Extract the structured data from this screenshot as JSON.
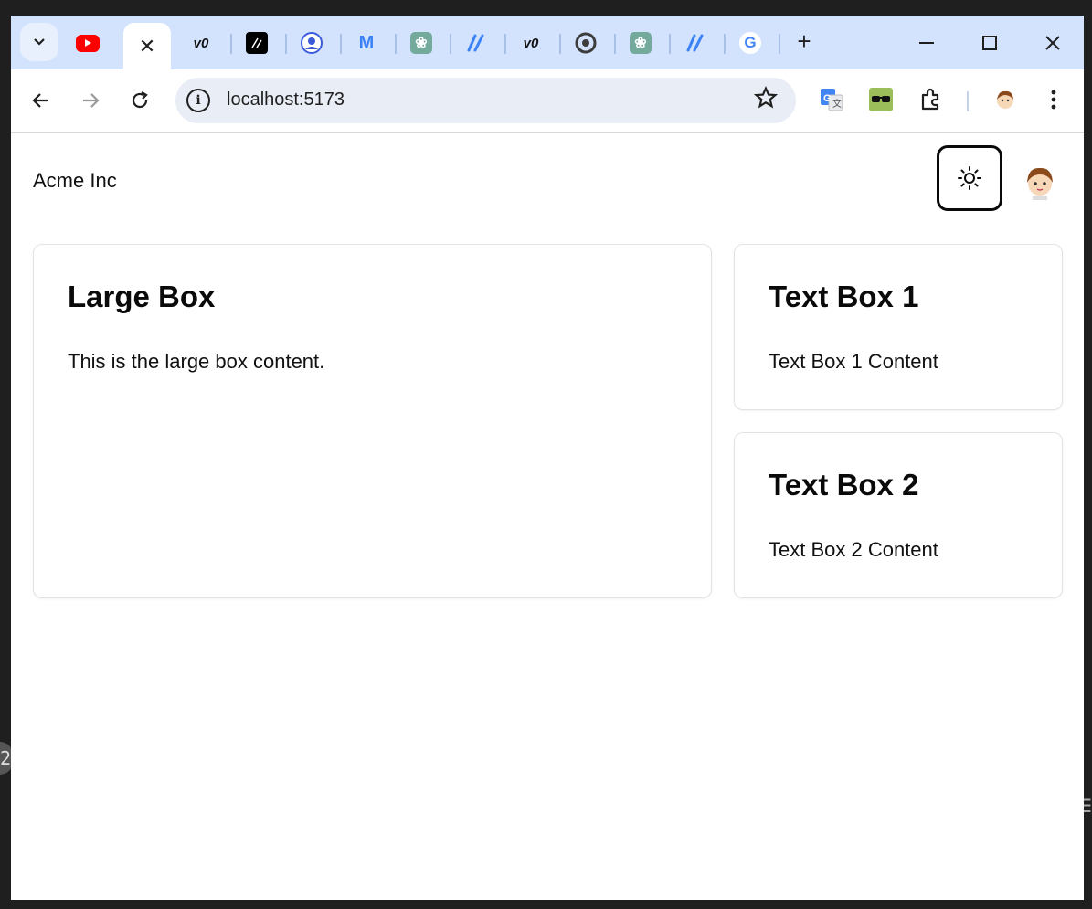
{
  "browser": {
    "url": "localhost:5173",
    "tabs": [
      {
        "icon": "youtube-icon",
        "color": "#ff0000"
      },
      {
        "icon": "close-icon",
        "glyph": "✕",
        "active": true
      },
      {
        "icon": "v0-icon",
        "glyph": "v0"
      },
      {
        "icon": "slash-app-icon",
        "glyph": "⁄⁄"
      },
      {
        "icon": "profile-circle-icon"
      },
      {
        "icon": "mui-icon",
        "glyph": "M"
      },
      {
        "icon": "chatgpt-icon",
        "glyph": "❀"
      },
      {
        "icon": "slash-blue-icon",
        "glyph": "//"
      },
      {
        "icon": "v0-icon",
        "glyph": "v0"
      },
      {
        "icon": "chrome-icon"
      },
      {
        "icon": "chatgpt-icon",
        "glyph": "❀"
      },
      {
        "icon": "slash-blue-icon",
        "glyph": "//"
      },
      {
        "icon": "google-icon",
        "glyph": "G"
      }
    ]
  },
  "header": {
    "brand": "Acme Inc",
    "theme_toggle_icon": "sun-icon"
  },
  "main": {
    "large_box": {
      "title": "Large Box",
      "content": "This is the large box content."
    },
    "text_box_1": {
      "title": "Text Box 1",
      "content": "Text Box 1 Content"
    },
    "text_box_2": {
      "title": "Text Box 2",
      "content": "Text Box 2 Content"
    }
  },
  "colors": {
    "tabstrip": "#d3e3fd",
    "omnibox": "#e9eef6",
    "card_border": "#e3e3e3"
  }
}
